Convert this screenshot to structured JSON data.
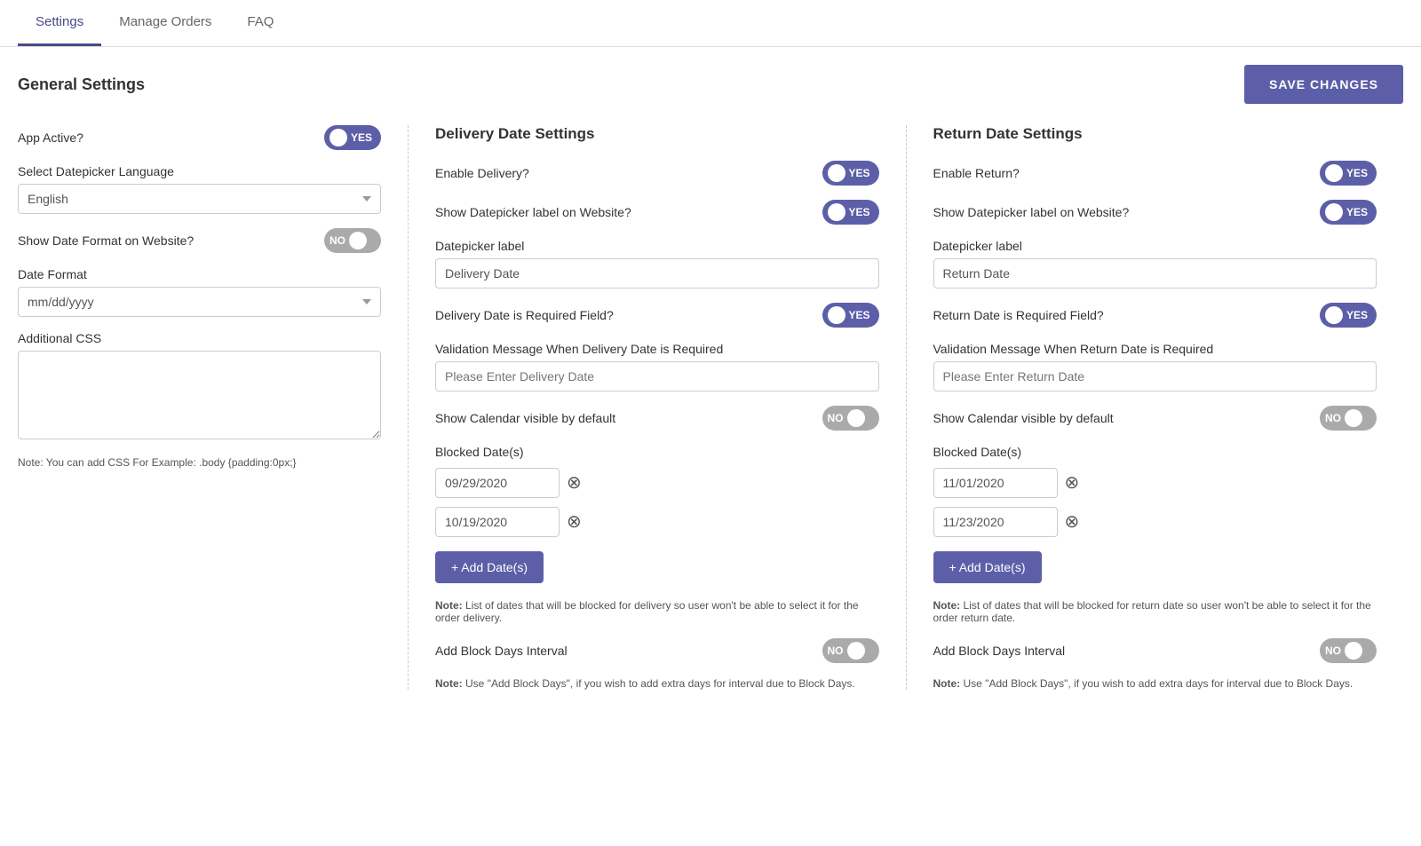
{
  "nav": {
    "tabs": [
      {
        "label": "Settings",
        "active": true
      },
      {
        "label": "Manage Orders",
        "active": false
      },
      {
        "label": "FAQ",
        "active": false
      }
    ]
  },
  "header": {
    "title": "General Settings",
    "save_button": "SAVE CHANGES"
  },
  "general": {
    "app_active_label": "App Active?",
    "app_active_toggle": "YES",
    "datepicker_language_label": "Select Datepicker Language",
    "datepicker_language_value": "English",
    "show_date_format_label": "Show Date Format on Website?",
    "show_date_format_toggle": "NO",
    "date_format_label": "Date Format",
    "date_format_value": "mm/dd/yyyy",
    "additional_css_label": "Additional CSS",
    "additional_css_placeholder": "",
    "css_note": "Note: You can add CSS For Example: .body {padding:0px;}"
  },
  "delivery": {
    "section_title": "Delivery Date Settings",
    "enable_label": "Enable Delivery?",
    "enable_toggle": "YES",
    "show_label_label": "Show Datepicker label on Website?",
    "show_label_toggle": "YES",
    "datepicker_label_label": "Datepicker label",
    "datepicker_label_value": "Delivery Date",
    "required_field_label": "Delivery Date is Required Field?",
    "required_toggle": "YES",
    "validation_label": "Validation Message When Delivery Date is Required",
    "validation_placeholder": "Please Enter Delivery Date",
    "calendar_visible_label": "Show Calendar visible by default",
    "calendar_visible_toggle": "NO",
    "blocked_dates_label": "Blocked Date(s)",
    "blocked_dates": [
      {
        "value": "09/29/2020"
      },
      {
        "value": "10/19/2020"
      }
    ],
    "add_dates_button": "+ Add Date(s)",
    "blocked_note": "Note: List of dates that will be blocked for delivery so user won't be able to select it for the order delivery.",
    "block_days_label": "Add Block Days Interval",
    "block_days_toggle": "NO",
    "block_days_note": "Note: Use \"Add Block Days\", if you wish to add extra days for interval due to Block Days."
  },
  "return": {
    "section_title": "Return Date Settings",
    "enable_label": "Enable Return?",
    "enable_toggle": "YES",
    "show_label_label": "Show Datepicker label on Website?",
    "show_label_toggle": "YES",
    "datepicker_label_label": "Datepicker label",
    "datepicker_label_value": "Return Date",
    "required_field_label": "Return Date is Required Field?",
    "required_toggle": "YES",
    "validation_label": "Validation Message When Return Date is Required",
    "validation_placeholder": "Please Enter Return Date",
    "calendar_visible_label": "Show Calendar visible by default",
    "calendar_visible_toggle": "NO",
    "blocked_dates_label": "Blocked Date(s)",
    "blocked_dates": [
      {
        "value": "11/01/2020"
      },
      {
        "value": "11/23/2020"
      }
    ],
    "add_dates_button": "+ Add Date(s)",
    "blocked_note": "Note: List of dates that will be blocked for return date so user won't be able to select it for the order return date.",
    "block_days_label": "Add Block Days Interval",
    "block_days_toggle": "NO",
    "block_days_note": "Note: Use \"Add Block Days\", if you wish to add extra days for interval due to Block Days."
  }
}
